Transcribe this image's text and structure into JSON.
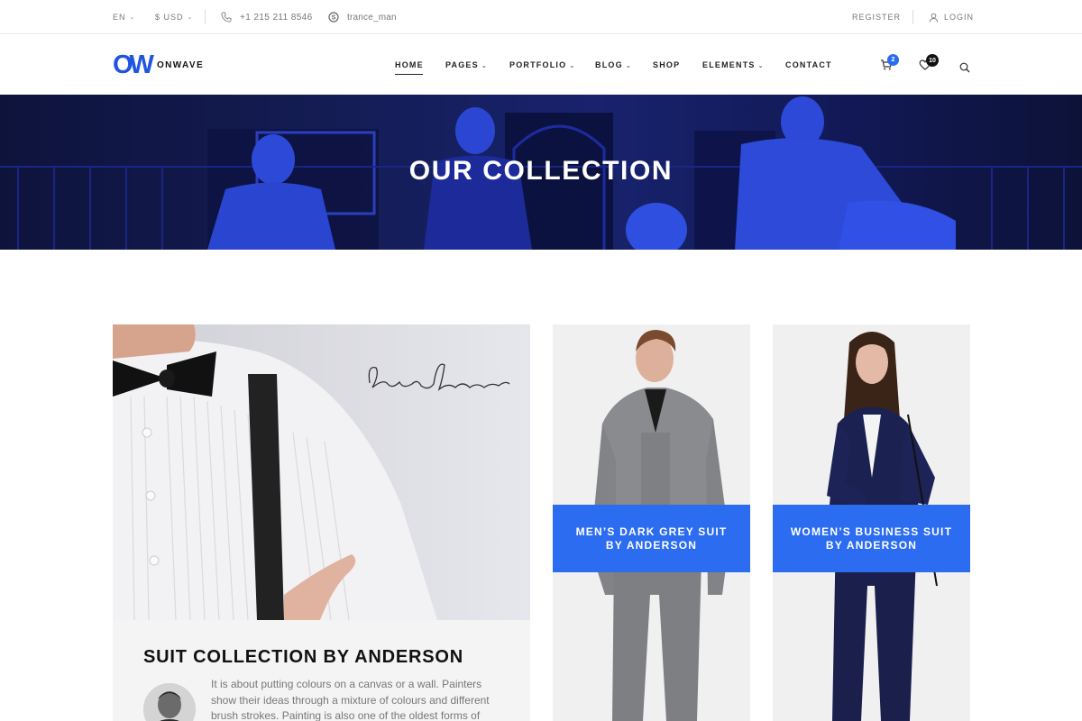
{
  "topbar": {
    "language": "EN",
    "currency": "$ USD",
    "phone": "+1 215 211 8546",
    "skype": "trance_man",
    "register": "REGISTER",
    "login": "LOGIN"
  },
  "header": {
    "logo_mark": "OW",
    "logo_text": "ONWAVE",
    "nav": {
      "home": "HOME",
      "pages": "PAGES",
      "portfolio": "PORTFOLIO",
      "blog": "BLOG",
      "shop": "SHOP",
      "elements": "ELEMENTS",
      "contact": "CONTACT"
    },
    "cart_count": "2",
    "wishlist_count": "10"
  },
  "hero": {
    "title": "OUR COLLECTION"
  },
  "feature": {
    "title": "SUIT COLLECTION BY ANDERSON",
    "signature": "Bryan Anderson",
    "description": "It is about putting colours on a canvas or a wall. Painters show their ideas through a mixture of colours and different brush strokes. Painting is also one of the oldest forms of visual art."
  },
  "products": [
    {
      "line1": "MEN’S DARK GREY SUIT",
      "line2": "BY ANDERSON"
    },
    {
      "line1": "WOMEN’S BUSINESS SUIT",
      "line2": "BY ANDERSON"
    }
  ],
  "colors": {
    "accent": "#2c6cf0",
    "logo": "#1f55e0",
    "hero": "#1c2a82",
    "wishlist_badge": "#111111"
  }
}
